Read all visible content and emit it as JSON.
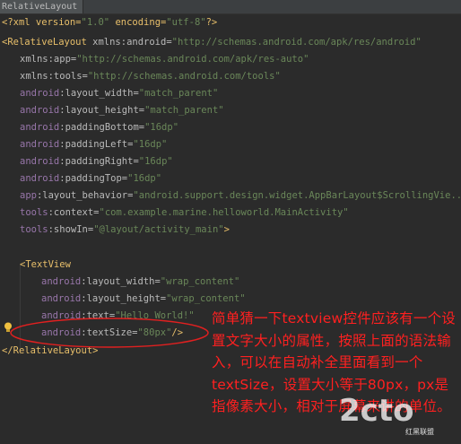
{
  "tab": {
    "label": "RelativeLayout"
  },
  "code": {
    "l1_a": "<?xml version=",
    "l1_v1": "\"1.0\"",
    "l1_b": " encoding=",
    "l1_v2": "\"utf-8\"",
    "l1_c": "?>",
    "l2_tag": "<RelativeLayout",
    "l2_attr": " xmlns:android=",
    "l2_val": "\"http://schemas.android.com/apk/res/android\"",
    "l3_attr": "xmlns:app=",
    "l3_val": "\"http://schemas.android.com/apk/res-auto\"",
    "l4_attr": "xmlns:tools=",
    "l4_val": "\"http://schemas.android.com/tools\"",
    "l5_ns": "android",
    "l5_attr": ":layout_width=",
    "l5_val": "\"match_parent\"",
    "l6_ns": "android",
    "l6_attr": ":layout_height=",
    "l6_val": "\"match_parent\"",
    "l7_ns": "android",
    "l7_attr": ":paddingBottom=",
    "l7_val": "\"16dp\"",
    "l8_ns": "android",
    "l8_attr": ":paddingLeft=",
    "l8_val": "\"16dp\"",
    "l9_ns": "android",
    "l9_attr": ":paddingRight=",
    "l9_val": "\"16dp\"",
    "l10_ns": "android",
    "l10_attr": ":paddingTop=",
    "l10_val": "\"16dp\"",
    "l11_ns": "app",
    "l11_attr": ":layout_behavior=",
    "l11_val": "\"android.support.design.widget.AppBarLayout$ScrollingVie...\"",
    "l12_ns": "tools",
    "l12_attr": ":context=",
    "l12_val": "\"com.example.marine.helloworld.MainActivity\"",
    "l13_ns": "tools",
    "l13_attr": ":showIn=",
    "l13_val": "\"@layout/activity_main\"",
    "l13_end": ">",
    "l15_tag": "<TextView",
    "l16_ns": "android",
    "l16_attr": ":layout_width=",
    "l16_val": "\"wrap_content\"",
    "l17_ns": "android",
    "l17_attr": ":layout_height=",
    "l17_val": "\"wrap_content\"",
    "l18_ns": "android",
    "l18_attr": ":text=",
    "l18_val": "\"Hello World!\"",
    "l19_ns": "android",
    "l19_attr": ":textSize=",
    "l19_val": "\"80px\"",
    "l19_end": "/>",
    "l20_tag": "</RelativeLayout>"
  },
  "annotation": {
    "text": "简单猜一下textview控件应该有一个设置文字大小的属性，按照上面的语法输入，可以在自动补全里面看到一个textSize，设置大小等于80px，px是指像素大小，相对于屏幕来讲的单位。"
  },
  "watermark": {
    "main": "2cto",
    "sub": "红黑联盟"
  },
  "colors": {
    "background": "#2b2b2b",
    "annotation": "#ff2020",
    "tag": "#e8bf6a",
    "string": "#6a8759"
  }
}
